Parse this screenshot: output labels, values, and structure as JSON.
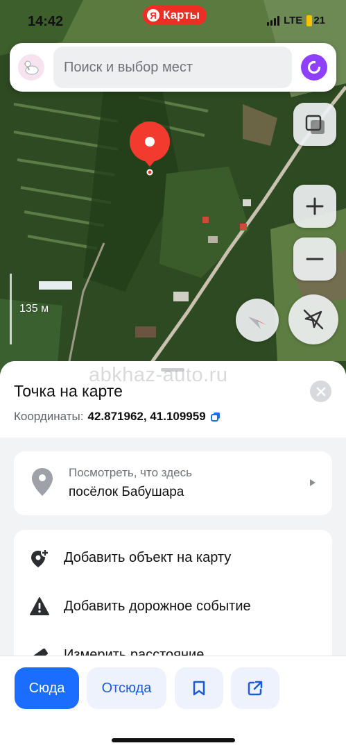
{
  "status_bar": {
    "time": "14:42",
    "app_brand": "Карты",
    "brand_letter": "Я",
    "network": "LTE",
    "battery": "21"
  },
  "search": {
    "placeholder": "Поиск и выбор мест"
  },
  "map": {
    "scale_label": "135 м"
  },
  "sheet": {
    "watermark": "abkhaz-auto.ru",
    "title": "Точка на карте",
    "coords_label": "Координаты:",
    "coords_value": "42.871962, 41.109959",
    "what_here": {
      "subtitle": "Посмотреть, что здесь",
      "place": "посёлок Бабушара"
    },
    "actions": [
      {
        "label": "Добавить объект на карту",
        "icon": "add-place-icon"
      },
      {
        "label": "Добавить дорожное событие",
        "icon": "warning-icon"
      },
      {
        "label": "Измерить расстояние",
        "icon": "ruler-icon"
      }
    ]
  },
  "bottom_bar": {
    "to_here": "Сюда",
    "from_here": "Отсюда",
    "bookmark_icon": "bookmark-icon",
    "share_icon": "share-icon"
  },
  "colors": {
    "brand_red": "#ee2e24",
    "primary_blue": "#1a6dff",
    "alice_purple": "#8f3fff"
  }
}
